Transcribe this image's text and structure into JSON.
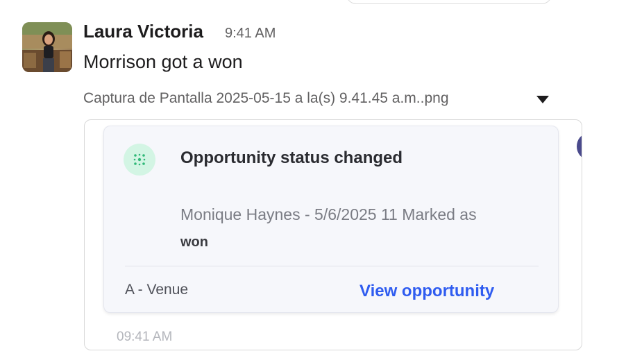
{
  "message": {
    "author": "Laura Victoria",
    "time": "9:41 AM",
    "text": "Morrison got a won"
  },
  "attachment": {
    "file_name": "Captura de Pantalla 2025-05-15 a la(s) 9.41.45 a.m..png",
    "notification": {
      "title": "Opportunity status changed",
      "body": "Monique Haynes - 5/6/2025 11 Marked as",
      "body_bold": "won",
      "venue": "A - Venue",
      "link_label": "View opportunity",
      "time": "09:41 AM"
    }
  },
  "colors": {
    "link": "#2f5cf0",
    "status_icon_bg": "#d3f5e4",
    "status_icon_fg": "#2fb878"
  },
  "icons": {
    "status": "sparkle-icon",
    "menu": "caret-down-icon"
  }
}
